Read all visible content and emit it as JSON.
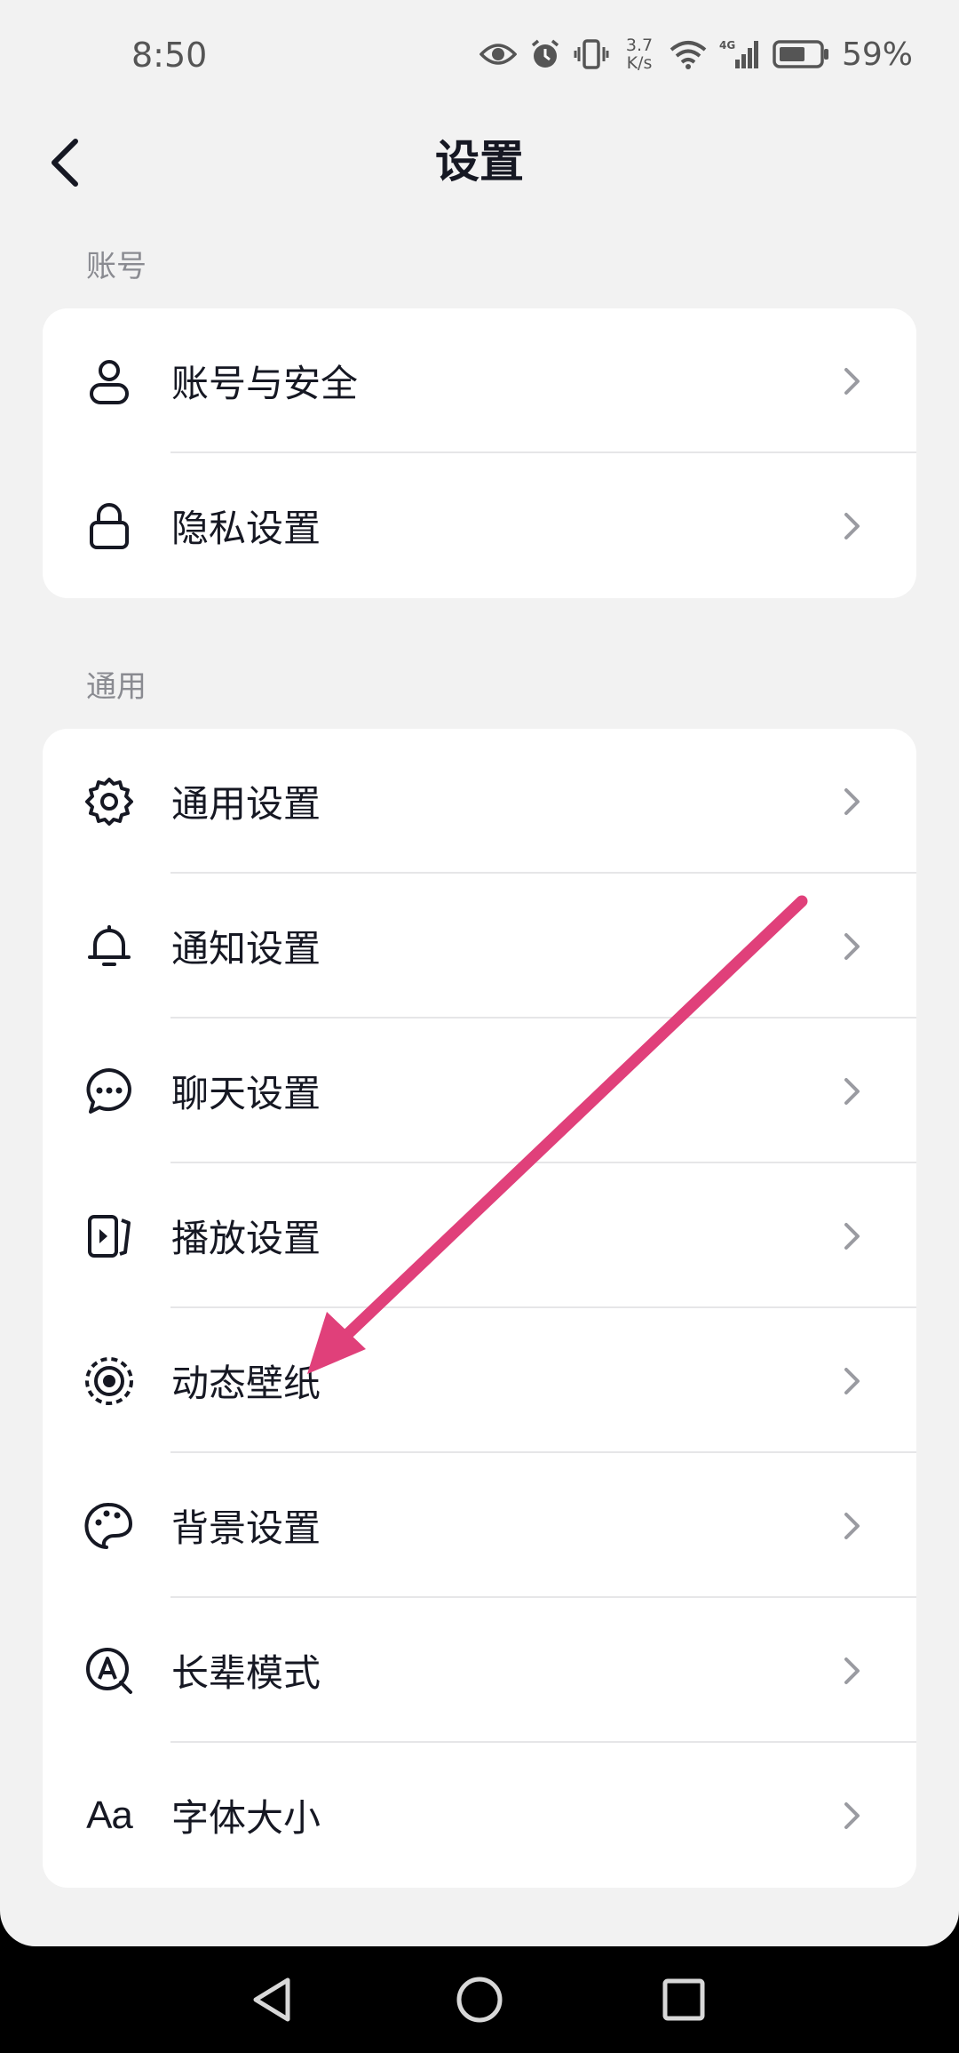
{
  "status_bar": {
    "time": "8:50",
    "net_speed_value": "3.7",
    "net_speed_unit": "K/s",
    "signal_label": "4G",
    "battery_percent": "59%"
  },
  "header": {
    "title": "设置"
  },
  "sections": [
    {
      "title": "账号",
      "items": [
        {
          "label": "账号与安全",
          "icon": "user-icon"
        },
        {
          "label": "隐私设置",
          "icon": "lock-icon"
        }
      ]
    },
    {
      "title": "通用",
      "items": [
        {
          "label": "通用设置",
          "icon": "gear-icon"
        },
        {
          "label": "通知设置",
          "icon": "bell-icon"
        },
        {
          "label": "聊天设置",
          "icon": "chat-bubble-icon"
        },
        {
          "label": "播放设置",
          "icon": "play-icon"
        },
        {
          "label": "动态壁纸",
          "icon": "live-wallpaper-icon"
        },
        {
          "label": "背景设置",
          "icon": "palette-icon"
        },
        {
          "label": "长辈模式",
          "icon": "elder-mode-icon"
        },
        {
          "label": "字体大小",
          "icon": "font-size-icon",
          "icon_text": "Aa"
        }
      ]
    }
  ],
  "colors": {
    "background": "#f2f2f2",
    "card": "#ffffff",
    "text": "#161823",
    "secondary_text": "#8a8b91",
    "annotation_arrow": "#e0407a"
  }
}
